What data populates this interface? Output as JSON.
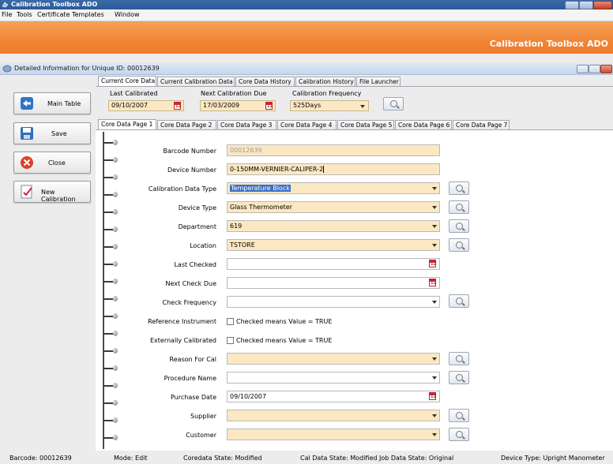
{
  "window": {
    "title": "Calibration Toolbox ADO"
  },
  "menu": [
    "File",
    "Tools",
    "Certificate Templates",
    "Window"
  ],
  "banner": {
    "brand": "Calibration Toolbox ADO"
  },
  "child_window": {
    "title": "Detailed Information for Unique ID: 00012639"
  },
  "sidebar": {
    "main_table": "Main Table",
    "save": "Save",
    "close": "Close",
    "new_calibration": "New Calibration"
  },
  "outer_tabs": [
    "Current Core Data",
    "Current Calibration Data",
    "Core Data History",
    "Calibration History",
    "File Launcher"
  ],
  "header": {
    "last_calibrated_label": "Last Calibrated",
    "last_calibrated": "09/10/2007",
    "next_due_label": "Next Calibration Due",
    "next_due": "17/03/2009",
    "frequency_label": "Calibration Frequency",
    "frequency": "525Days"
  },
  "inner_tabs": [
    "Core Data Page 1",
    "Core Data Page 2",
    "Core Data Page 3",
    "Core Data Page 4",
    "Core Data Page 5",
    "Core Data Page 6",
    "Core Data Page 7"
  ],
  "form": {
    "barcode_label": "Barcode Number",
    "barcode": "00012639",
    "device_number_label": "Device Number",
    "device_number": "0-150MM-VERNIER-CALIPER-2",
    "cal_type_label": "Calibration Data Type",
    "cal_type": "Temperature Block",
    "device_type_label": "Device Type",
    "device_type": "Glass Thermometer",
    "department_label": "Department",
    "department": "619",
    "location_label": "Location",
    "location": "TSTORE",
    "last_checked_label": "Last Checked",
    "last_checked": "",
    "next_check_label": "Next Check Due",
    "next_check": "",
    "check_freq_label": "Check Frequency",
    "check_freq": "",
    "ref_instr_label": "Reference Instrument",
    "ref_instr_note": "Checked means Value = TRUE",
    "ext_cal_label": "Externally Calibrated",
    "ext_cal_note": "Checked means Value = TRUE",
    "reason_label": "Reason For Cal",
    "reason": "",
    "procedure_label": "Procedure Name",
    "procedure": "",
    "purchase_label": "Purchase Date",
    "purchase": "09/10/2007",
    "supplier_label": "Supplier",
    "supplier": "",
    "customer_label": "Customer",
    "customer": ""
  },
  "calendar_icon_text": "12",
  "status": {
    "barcode": "Barcode: 00012639",
    "mode": "Mode: Edit",
    "coredata": "Coredata State: Modified",
    "caldata": "Cal Data State:  Modified",
    "jobdata": "Job Data State:  Original",
    "devicetype": "Device Type:   Upright Manometer"
  }
}
